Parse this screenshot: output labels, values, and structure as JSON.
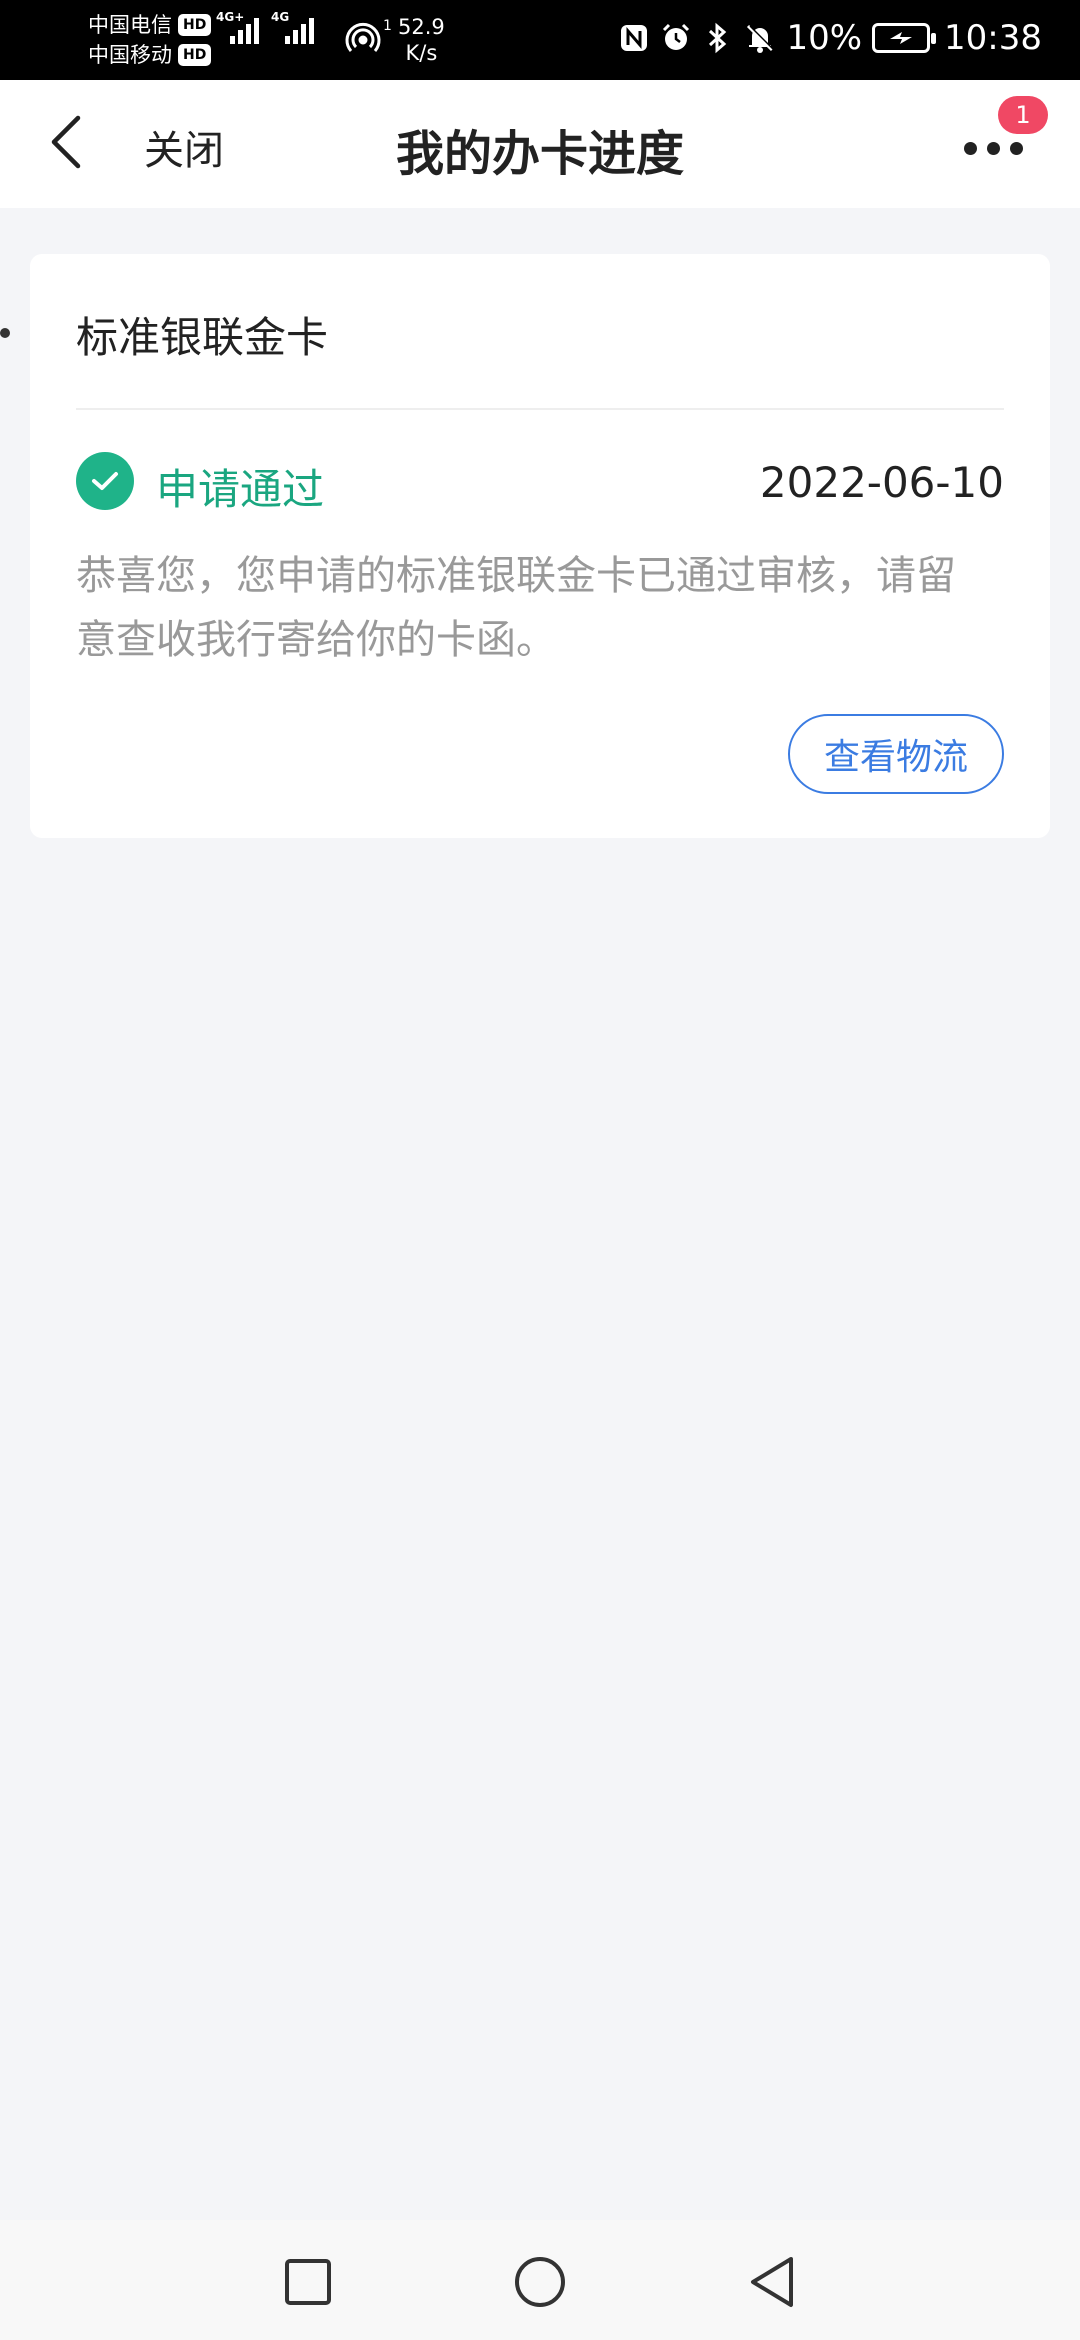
{
  "status_bar": {
    "carrier_1": "中国电信",
    "carrier_2": "中国移动",
    "hd_label": "HD",
    "network_1": "4G+",
    "network_2": "4G",
    "hotspot_count": "1",
    "speed_value": "52.9",
    "speed_unit": "K/s",
    "battery_percent": "10%",
    "time": "10:38"
  },
  "nav": {
    "close_label": "关闭",
    "title": "我的办卡进度",
    "more_badge": "1"
  },
  "card": {
    "title": "标准银联金卡",
    "status": "申请通过",
    "date": "2022-06-10",
    "description": "恭喜您，您申请的标准银联金卡已通过审核，请留意查收我行寄给你的卡函。",
    "logistics_button": "查看物流"
  },
  "colors": {
    "accent_green": "#1fb389",
    "link_blue": "#3b7ce2",
    "badge_red": "#f04864",
    "page_bg": "#f4f5f8"
  },
  "icons": {
    "back": "chevron-left-icon",
    "more": "more-dots-icon",
    "status": "check-circle-icon",
    "sys_recent": "square-icon",
    "sys_home": "circle-icon",
    "sys_back": "triangle-left-icon"
  }
}
